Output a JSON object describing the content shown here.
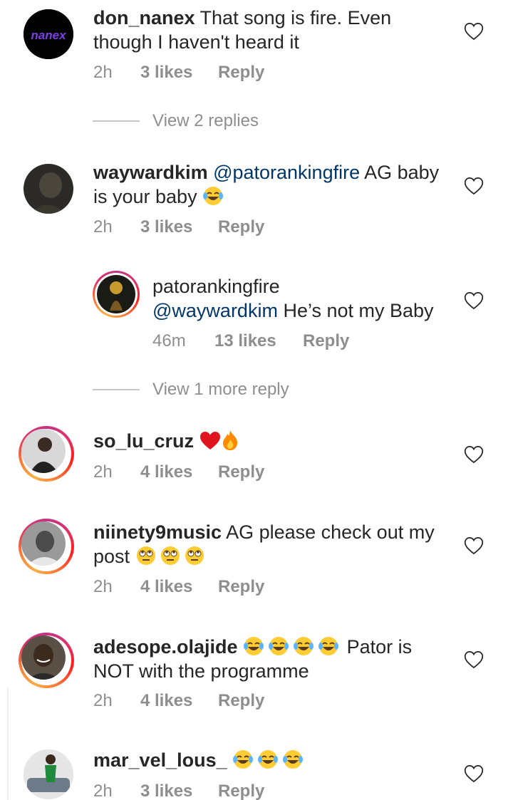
{
  "comments": [
    {
      "username": "don_nanex",
      "text": " That song is fire. Even though I haven't heard it",
      "time": "2h",
      "likes": "3 likes",
      "reply": "Reply",
      "avatar_text": "nanex"
    },
    {
      "username": "waywardkim",
      "mention": " @patorankingfire",
      "text": " AG baby is your baby",
      "time": "2h",
      "likes": "3 likes",
      "reply": "Reply"
    },
    {
      "username": "patorankingfire",
      "mention": "@waywardkim",
      "text": " He’s not my Baby",
      "time": "46m",
      "likes": "13 likes",
      "reply": "Reply"
    },
    {
      "username": "so_lu_cruz",
      "text": "",
      "time": "2h",
      "likes": "4 likes",
      "reply": "Reply"
    },
    {
      "username": "niinety9music",
      "text": " AG please check out my post",
      "time": "2h",
      "likes": "4 likes",
      "reply": "Reply"
    },
    {
      "username": "adesope.olajide",
      "text": " Pator is NOT with the programme",
      "time": "2h",
      "likes": "4 likes",
      "reply": "Reply"
    },
    {
      "username": "mar_vel_lous_",
      "text": "",
      "time": "2h",
      "likes": "3 likes",
      "reply": "Reply"
    }
  ],
  "view_replies": [
    "View 2 replies",
    "View 1 more reply"
  ],
  "colors": {
    "mention": "#00376b",
    "meta": "#8e8e8e",
    "text": "#262626"
  },
  "icons": [
    "heart-outline-icon",
    "laughing-emoji",
    "rolling-eyes-emoji",
    "red-heart-emoji",
    "fire-emoji"
  ]
}
